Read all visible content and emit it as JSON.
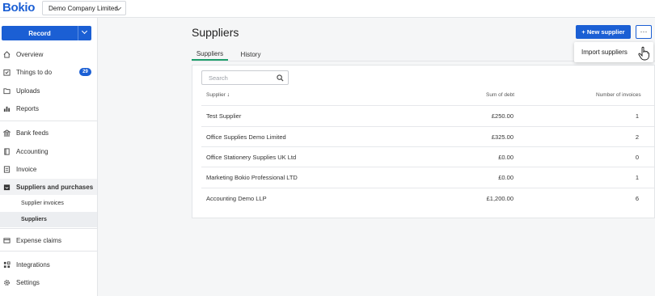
{
  "header": {
    "logo": "Bokio",
    "company": "Demo Company Limited"
  },
  "sidebar": {
    "record_label": "Record",
    "items": [
      {
        "label": "Overview",
        "icon": "home-icon"
      },
      {
        "label": "Things to do",
        "icon": "checklist-icon",
        "badge": "29"
      },
      {
        "label": "Uploads",
        "icon": "folder-icon"
      },
      {
        "label": "Reports",
        "icon": "bar-chart-icon"
      },
      {
        "label": "Bank feeds",
        "icon": "bank-icon"
      },
      {
        "label": "Accounting",
        "icon": "book-icon"
      },
      {
        "label": "Invoice",
        "icon": "invoice-icon"
      },
      {
        "label": "Suppliers and purchases",
        "icon": "inbox-icon"
      },
      {
        "label": "Expense claims",
        "icon": "card-icon"
      },
      {
        "label": "Integrations",
        "icon": "integrations-icon"
      },
      {
        "label": "Settings",
        "icon": "gear-icon"
      }
    ],
    "sub_items": [
      {
        "label": "Supplier invoices"
      },
      {
        "label": "Suppliers"
      }
    ]
  },
  "main": {
    "title": "Suppliers",
    "new_button": "+ New supplier",
    "more_button": "···",
    "dropdown_item": "Import suppliers",
    "tabs": [
      {
        "label": "Suppliers"
      },
      {
        "label": "History"
      }
    ],
    "search_placeholder": "Search",
    "columns": {
      "supplier": "Supplier",
      "debt": "Sum of debt",
      "invoices": "Number of invoices"
    },
    "rows": [
      {
        "name": "Test Supplier",
        "debt": "£250.00",
        "invoices": "1"
      },
      {
        "name": "Office Supplies Demo Limited",
        "debt": "£325.00",
        "invoices": "2"
      },
      {
        "name": "Office Stationery Supplies UK Ltd",
        "debt": "£0.00",
        "invoices": "0"
      },
      {
        "name": "Marketing Bokio Professional LTD",
        "debt": "£0.00",
        "invoices": "1"
      },
      {
        "name": "Accounting Demo LLP",
        "debt": "£1,200.00",
        "invoices": "6"
      }
    ]
  },
  "colors": {
    "brand": "#1b5fd4",
    "tab_active": "#1e9e6b"
  }
}
